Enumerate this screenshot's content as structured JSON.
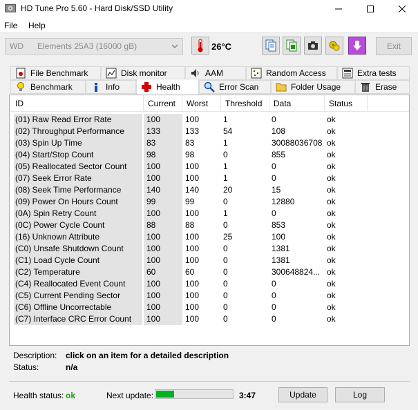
{
  "window": {
    "title": "HD Tune Pro 5.60 - Hard Disk/SSD Utility"
  },
  "menu": {
    "file": "File",
    "help": "Help"
  },
  "toolbar": {
    "drive_vendor": "WD",
    "drive_model": "Elements 25A3 (16000 gB)",
    "temperature": "26°C",
    "exit_label": "Exit"
  },
  "tabs_row1": [
    {
      "label": "File Benchmark"
    },
    {
      "label": "Disk monitor"
    },
    {
      "label": "AAM"
    },
    {
      "label": "Random Access"
    },
    {
      "label": "Extra tests"
    }
  ],
  "tabs_row2": [
    {
      "label": "Benchmark"
    },
    {
      "label": "Info"
    },
    {
      "label": "Health"
    },
    {
      "label": "Error Scan"
    },
    {
      "label": "Folder Usage"
    },
    {
      "label": "Erase"
    }
  ],
  "table": {
    "headers": {
      "id": "ID",
      "current": "Current",
      "worst": "Worst",
      "threshold": "Threshold",
      "data": "Data",
      "status": "Status"
    },
    "rows": [
      {
        "id": "(01) Raw Read Error Rate",
        "current": "100",
        "worst": "100",
        "threshold": "1",
        "data": "0",
        "status": "ok"
      },
      {
        "id": "(02) Throughput Performance",
        "current": "133",
        "worst": "133",
        "threshold": "54",
        "data": "108",
        "status": "ok"
      },
      {
        "id": "(03) Spin Up Time",
        "current": "83",
        "worst": "83",
        "threshold": "1",
        "data": "30088036708",
        "status": "ok"
      },
      {
        "id": "(04) Start/Stop Count",
        "current": "98",
        "worst": "98",
        "threshold": "0",
        "data": "855",
        "status": "ok"
      },
      {
        "id": "(05) Reallocated Sector Count",
        "current": "100",
        "worst": "100",
        "threshold": "1",
        "data": "0",
        "status": "ok"
      },
      {
        "id": "(07) Seek Error Rate",
        "current": "100",
        "worst": "100",
        "threshold": "1",
        "data": "0",
        "status": "ok"
      },
      {
        "id": "(08) Seek Time Performance",
        "current": "140",
        "worst": "140",
        "threshold": "20",
        "data": "15",
        "status": "ok"
      },
      {
        "id": "(09) Power On Hours Count",
        "current": "99",
        "worst": "99",
        "threshold": "0",
        "data": "12880",
        "status": "ok"
      },
      {
        "id": "(0A) Spin Retry Count",
        "current": "100",
        "worst": "100",
        "threshold": "1",
        "data": "0",
        "status": "ok"
      },
      {
        "id": "(0C) Power Cycle Count",
        "current": "88",
        "worst": "88",
        "threshold": "0",
        "data": "853",
        "status": "ok"
      },
      {
        "id": "(16) Unknown Attribute",
        "current": "100",
        "worst": "100",
        "threshold": "25",
        "data": "100",
        "status": "ok"
      },
      {
        "id": "(C0) Unsafe Shutdown Count",
        "current": "100",
        "worst": "100",
        "threshold": "0",
        "data": "1381",
        "status": "ok"
      },
      {
        "id": "(C1) Load Cycle Count",
        "current": "100",
        "worst": "100",
        "threshold": "0",
        "data": "1381",
        "status": "ok"
      },
      {
        "id": "(C2) Temperature",
        "current": "60",
        "worst": "60",
        "threshold": "0",
        "data": "300648824...",
        "status": "ok"
      },
      {
        "id": "(C4) Reallocated Event Count",
        "current": "100",
        "worst": "100",
        "threshold": "0",
        "data": "0",
        "status": "ok"
      },
      {
        "id": "(C5) Current Pending Sector",
        "current": "100",
        "worst": "100",
        "threshold": "0",
        "data": "0",
        "status": "ok"
      },
      {
        "id": "(C6) Offline Uncorrectable",
        "current": "100",
        "worst": "100",
        "threshold": "0",
        "data": "0",
        "status": "ok"
      },
      {
        "id": "(C7) Interface CRC Error Count",
        "current": "100",
        "worst": "100",
        "threshold": "0",
        "data": "0",
        "status": "ok"
      }
    ]
  },
  "details": {
    "description_label": "Description:",
    "description_value": "click on an item for a detailed description",
    "status_label": "Status:",
    "status_value": "n/a"
  },
  "footer": {
    "health_label": "Health status:",
    "health_value": "ok",
    "next_update_label": "Next update:",
    "progress_fraction": 0.24,
    "countdown": "3:47",
    "update_label": "Update",
    "log_label": "Log"
  },
  "colors": {
    "ok_green": "#14a800",
    "progress_green": "#06b025"
  }
}
